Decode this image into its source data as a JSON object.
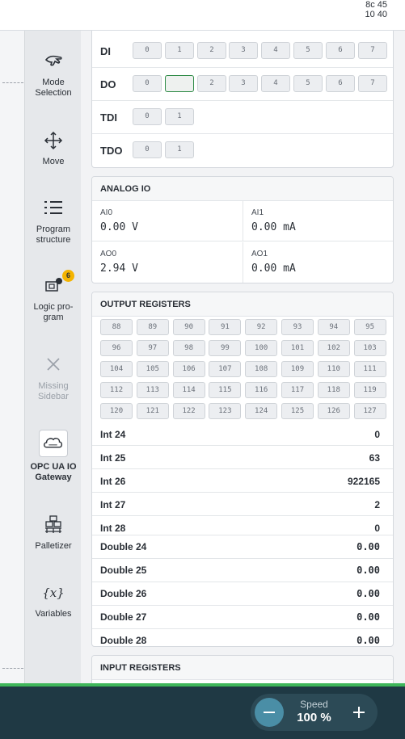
{
  "clock": {
    "line1": "8c 45",
    "line2": "10 40"
  },
  "sidebar": {
    "items": [
      {
        "label": "Mode Selection",
        "icon": "hand-icon"
      },
      {
        "label": "Move",
        "icon": "move-arrows-icon"
      },
      {
        "label": "Program structure",
        "icon": "list-icon"
      },
      {
        "label": "Logic pro-gram",
        "icon": "logic-icon",
        "badge": "6"
      },
      {
        "label": "Missing Sidebar",
        "icon": "close-icon",
        "disabled": true
      },
      {
        "label": "OPC UA IO Gateway",
        "icon": "opc-cloud-icon",
        "active": true
      },
      {
        "label": "Palletizer",
        "icon": "pallet-icon"
      },
      {
        "label": "Variables",
        "icon": "variables-icon",
        "glyph": "{x}"
      }
    ]
  },
  "digital_io": {
    "rows": [
      {
        "label": "DI",
        "chips": [
          "0",
          "1",
          "2",
          "3",
          "4",
          "5",
          "6",
          "7"
        ]
      },
      {
        "label": "DO",
        "chips": [
          "0",
          "1",
          "2",
          "3",
          "4",
          "5",
          "6",
          "7"
        ],
        "selected": 1
      },
      {
        "label": "TDI",
        "chips": [
          "0",
          "1"
        ]
      },
      {
        "label": "TDO",
        "chips": [
          "0",
          "1"
        ]
      }
    ]
  },
  "analog_io": {
    "title": "ANALOG IO",
    "cells": [
      {
        "name": "AI0",
        "value": "0.00 V"
      },
      {
        "name": "AI1",
        "value": "0.00 mA"
      },
      {
        "name": "AO0",
        "value": "2.94 V"
      },
      {
        "name": "AO1",
        "value": "0.00 mA"
      }
    ]
  },
  "output_registers": {
    "title": "OUTPUT REGISTERS",
    "numbers": [
      "88",
      "89",
      "90",
      "91",
      "92",
      "93",
      "94",
      "95",
      "96",
      "97",
      "98",
      "99",
      "100",
      "101",
      "102",
      "103",
      "104",
      "105",
      "106",
      "107",
      "108",
      "109",
      "110",
      "111",
      "112",
      "113",
      "114",
      "115",
      "116",
      "117",
      "118",
      "119",
      "120",
      "121",
      "122",
      "123",
      "124",
      "125",
      "126",
      "127"
    ],
    "ints": [
      {
        "name": "Int 24",
        "value": "0"
      },
      {
        "name": "Int 25",
        "value": "63"
      },
      {
        "name": "Int 26",
        "value": "922165"
      },
      {
        "name": "Int 27",
        "value": "2"
      },
      {
        "name": "Int 28",
        "value": "0"
      }
    ],
    "doubles": [
      {
        "name": "Double 24",
        "value": "0.00"
      },
      {
        "name": "Double 25",
        "value": "0.00"
      },
      {
        "name": "Double 26",
        "value": "0.00"
      },
      {
        "name": "Double 27",
        "value": "0.00"
      },
      {
        "name": "Double 28",
        "value": "0.00"
      }
    ]
  },
  "input_registers": {
    "title": "INPUT REGISTERS"
  },
  "speed": {
    "label": "Speed",
    "value": "100 %",
    "minus": "−",
    "plus": "+"
  },
  "colors": {
    "accent_green": "#3fb65a",
    "footer": "#1f3944",
    "badge": "#f4b400",
    "selected_chip": "#2e8b46"
  }
}
